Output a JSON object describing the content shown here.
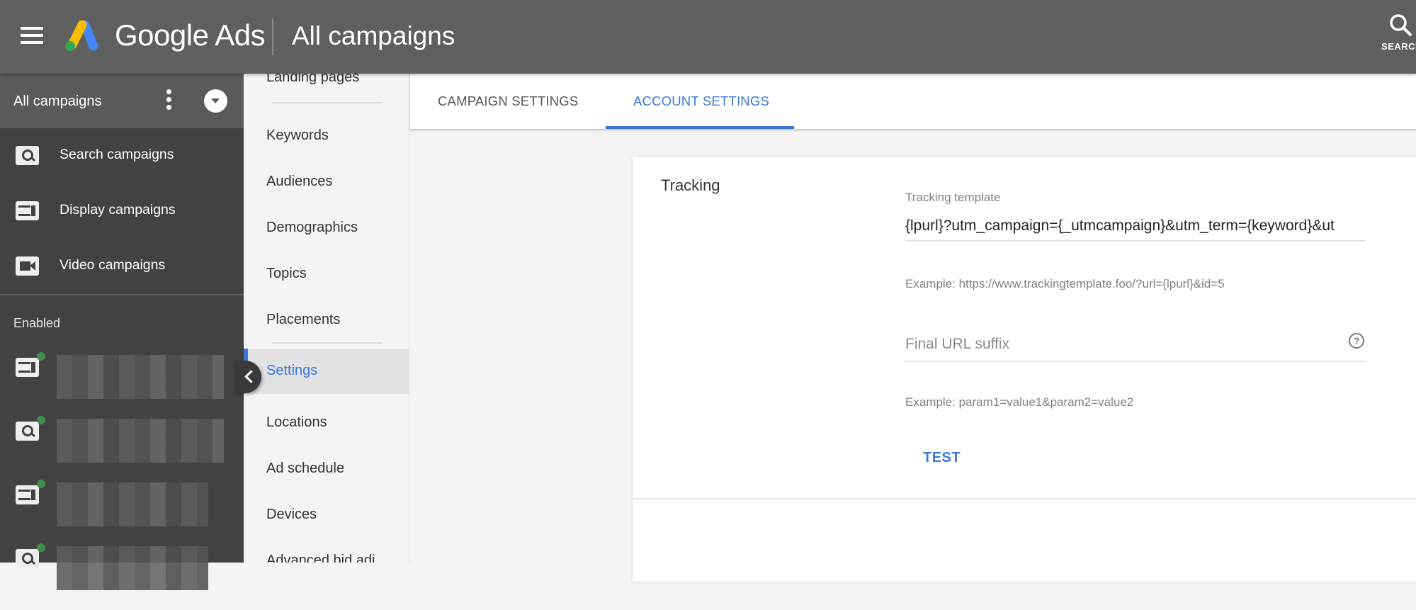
{
  "header": {
    "brand": "Google Ads",
    "page_title": "All campaigns",
    "search_label": "SEARCH"
  },
  "leftnav": {
    "scope_label": "All campaigns",
    "items": [
      {
        "label": "Search campaigns",
        "icon": "search-icon"
      },
      {
        "label": "Display campaigns",
        "icon": "display-icon"
      },
      {
        "label": "Video campaigns",
        "icon": "video-icon"
      }
    ],
    "section_title": "Enabled",
    "campaigns": [
      {
        "type": "display",
        "status": "enabled",
        "name_visible": false
      },
      {
        "type": "search",
        "status": "enabled",
        "name_visible": false
      },
      {
        "type": "display",
        "status": "enabled",
        "name_visible": false
      },
      {
        "type": "search",
        "status": "enabled",
        "name_visible": false
      }
    ]
  },
  "pagemenu": {
    "items": [
      {
        "label": "Landing pages"
      },
      {
        "label": "Keywords"
      },
      {
        "label": "Audiences"
      },
      {
        "label": "Demographics"
      },
      {
        "label": "Topics"
      },
      {
        "label": "Placements"
      },
      {
        "label": "Settings",
        "active": true
      },
      {
        "label": "Locations"
      },
      {
        "label": "Ad schedule"
      },
      {
        "label": "Devices"
      },
      {
        "label": "Advanced bid adj."
      }
    ]
  },
  "tabs": [
    {
      "label": "CAMPAIGN SETTINGS",
      "active": false
    },
    {
      "label": "ACCOUNT SETTINGS",
      "active": true
    }
  ],
  "tracking": {
    "title": "Tracking",
    "template_label": "Tracking template",
    "template_value": "{lpurl}?utm_campaign={_utmcampaign}&utm_term={keyword}&ut",
    "template_hint": "Example: https://www.trackingtemplate.foo/?url={lpurl}&id=5",
    "suffix_placeholder": "Final URL suffix",
    "suffix_value": "",
    "suffix_hint": "Example: param1=value1&param2=value2",
    "test_label": "TEST"
  },
  "colors": {
    "accent": "#3b78d8",
    "topbar": "#5f5f5f",
    "leftnav": "#424242",
    "status_enabled": "#3f8e4d"
  }
}
